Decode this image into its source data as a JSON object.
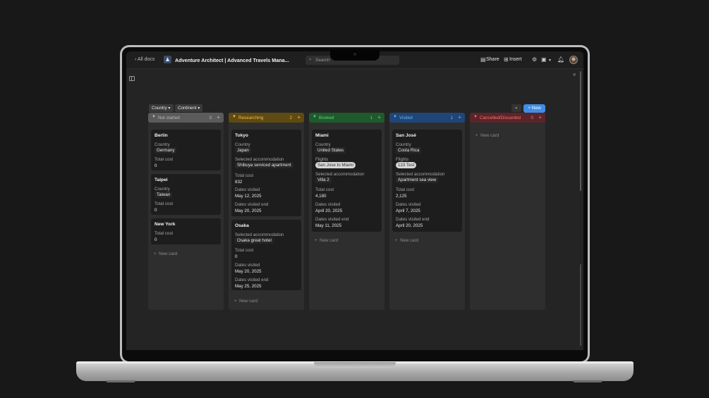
{
  "topbar": {
    "all_docs": "‹ All docs",
    "doc_title": "Adventure Architect | Advanced Travels Mana...",
    "search_placeholder": "Search",
    "share": "Share",
    "insert": "Insert"
  },
  "toolbar": {
    "filters": [
      "Country",
      "Continent"
    ],
    "new_label": "+ New"
  },
  "columns": [
    {
      "name": "Not started",
      "count": "3",
      "color": "#5b5b5b",
      "text": "#b9b9b9"
    },
    {
      "name": "Researching",
      "count": "2",
      "color": "#5e4a12",
      "text": "#f0c040"
    },
    {
      "name": "Booked",
      "count": "1",
      "color": "#1e5a2c",
      "text": "#5fd27d"
    },
    {
      "name": "Visited",
      "count": "1",
      "color": "#1f4677",
      "text": "#6fb0ff"
    },
    {
      "name": "Cancelled/Discarded",
      "count": "0",
      "color": "#5a2528",
      "text": "#ff6f78"
    }
  ],
  "cards": {
    "berlin": {
      "title": "Berlin",
      "country_label": "Country",
      "country": "Germany",
      "cost_label": "Total cost",
      "cost": "0"
    },
    "taipei": {
      "title": "Taipei",
      "country_label": "Country",
      "country": "Taiwan",
      "cost_label": "Total cost",
      "cost": "0"
    },
    "newyork": {
      "title": "New York",
      "cost_label": "Total cost",
      "cost": "0"
    },
    "tokyo": {
      "title": "Tokyo",
      "country_label": "Country",
      "country": "Japan",
      "acc_label": "Selected accommodation",
      "acc": "Shibuya serviced apartment",
      "cost_label": "Total cost",
      "cost": "832",
      "dv_label": "Dates visited",
      "dv": "May 12, 2025",
      "dve_label": "Dates visited end",
      "dve": "May 20, 2025"
    },
    "osaka": {
      "title": "Osaka",
      "acc_label": "Selected accommodation",
      "acc": "Osaka great hotel",
      "cost_label": "Total cost",
      "cost": "0",
      "dv_label": "Dates visited",
      "dv": "May 20, 2025",
      "dve_label": "Dates visited end",
      "dve": "May 25, 2025"
    },
    "miami": {
      "title": "Miami",
      "country_label": "Country",
      "country": "United States",
      "flights_label": "Flights",
      "flights": "San Jose to Miami",
      "acc_label": "Selected accommodation",
      "acc": "Villa 2",
      "cost_label": "Total cost",
      "cost": "4,180",
      "dv_label": "Dates visited",
      "dv": "April 20, 2025",
      "dve_label": "Dates visited end",
      "dve": "May 11, 2025"
    },
    "sanjose": {
      "title": "San José",
      "country_label": "Country",
      "country": "Costa Rica",
      "flights_label": "Flights",
      "flights": "123 Test",
      "acc_label": "Selected accommodation",
      "acc": "Apartment sea view",
      "cost_label": "Total cost",
      "cost": "2,125",
      "dv_label": "Dates visited",
      "dv": "April 7, 2025",
      "dve_label": "Dates visited end",
      "dve": "April 20, 2025"
    }
  },
  "new_card_label": "New card"
}
